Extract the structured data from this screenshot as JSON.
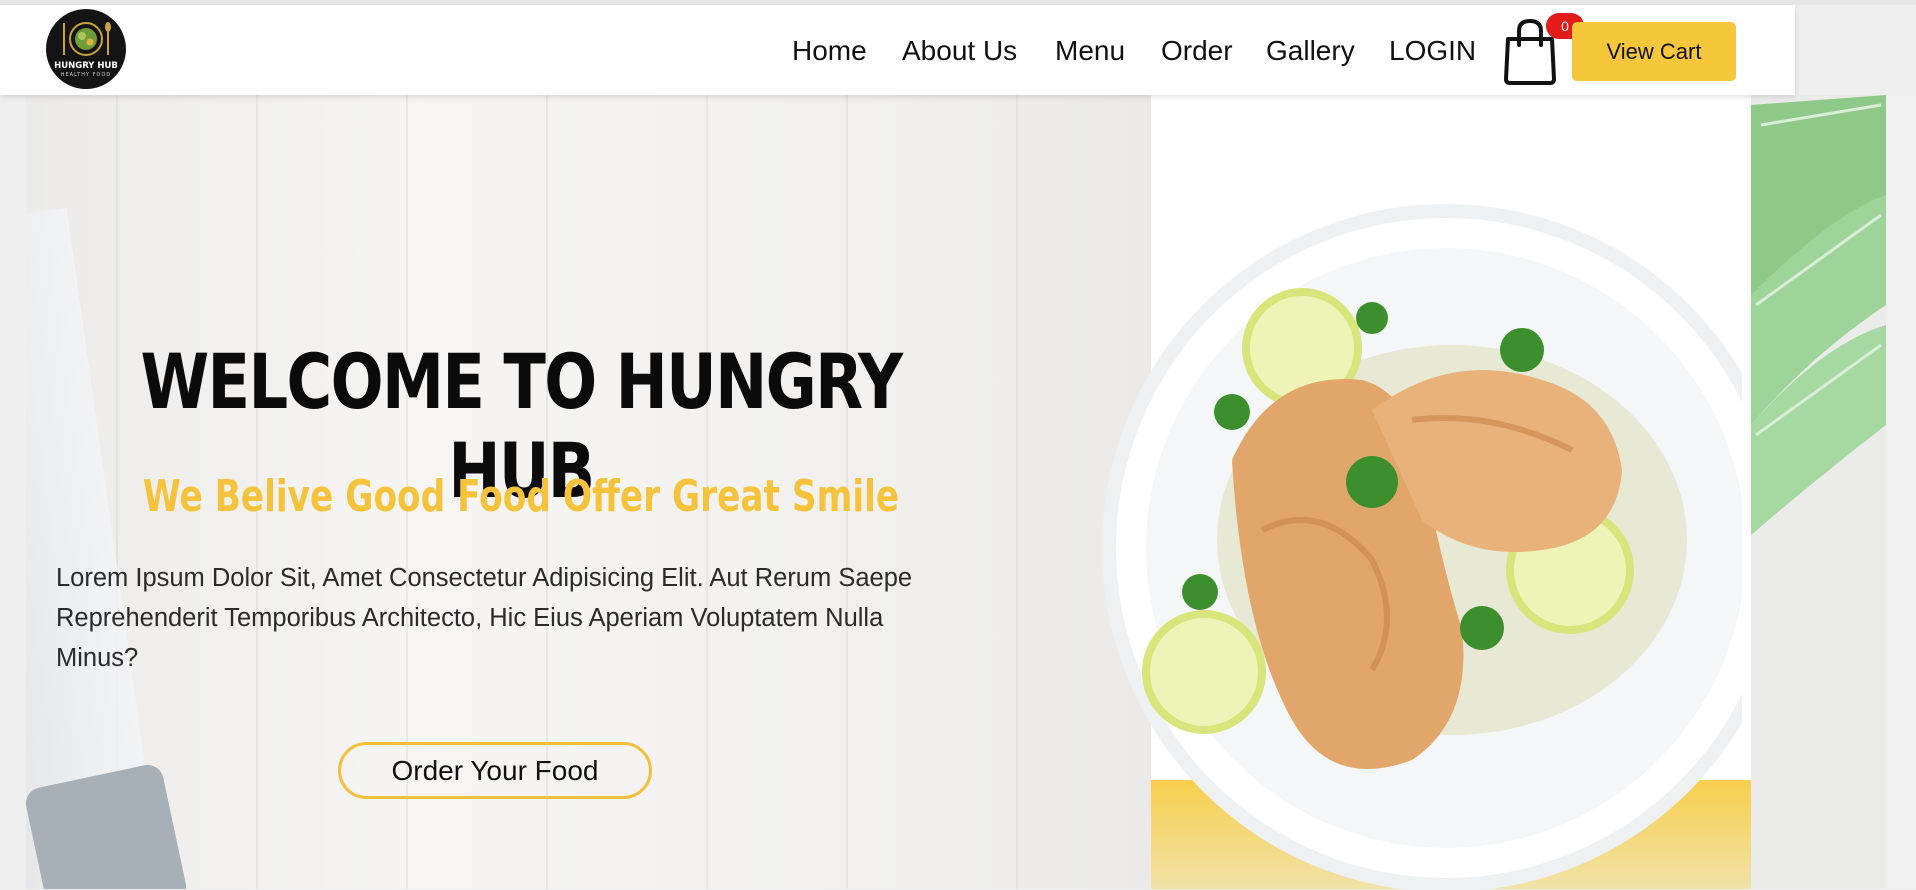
{
  "brand": {
    "logo_title": "HUNGRY HUB",
    "logo_subtitle": "HEALTHY FOOD"
  },
  "nav": {
    "items": [
      {
        "label": "Home"
      },
      {
        "label": "About Us"
      },
      {
        "label": "Menu"
      },
      {
        "label": "Order"
      },
      {
        "label": "Gallery"
      },
      {
        "label": "LOGIN"
      }
    ],
    "cart_count": "0",
    "view_cart_label": "View Cart",
    "cart_icon": "shopping-bag-icon"
  },
  "hero": {
    "title": "WELCOME TO HUNGRY HUB",
    "subtitle": "We Belive Good Food Offer Great Smile",
    "text": "Lorem Ipsum Dolor Sit, Amet Consectetur Adipisicing Elit. Aut Rerum Saepe Reprehenderit Temporibus Architecto, Hic Eius Aperiam Voluptatem Nulla Minus?",
    "cta_label": "Order Your Food"
  },
  "colors": {
    "accent": "#f6c63b",
    "badge": "#e31b1b",
    "text": "#111111"
  }
}
